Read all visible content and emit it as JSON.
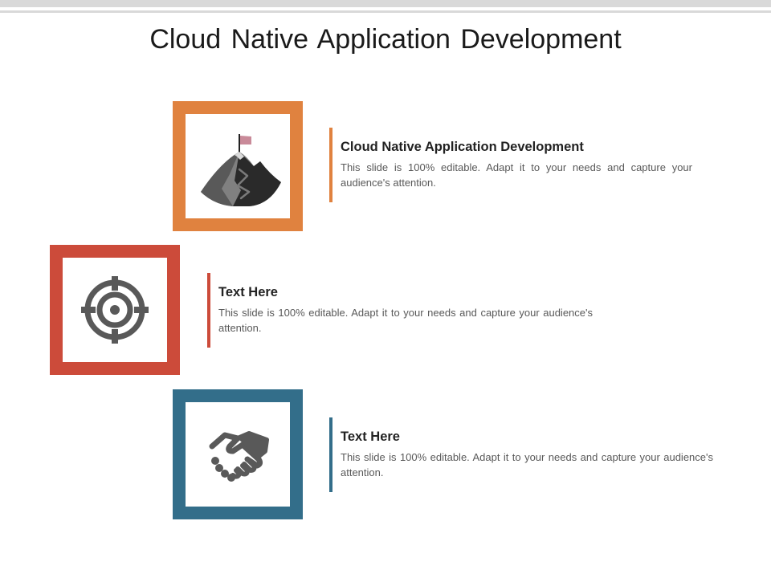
{
  "slide": {
    "title": "Cloud Native Application Development"
  },
  "items": [
    {
      "heading": "Cloud Native Application Development",
      "body": "This slide is 100% editable. Adapt it to your needs and capture your audience's attention.",
      "accent_color": "#E0823F",
      "icon": "mountain-flag-icon"
    },
    {
      "heading": "Text Here",
      "body": "This slide is 100% editable. Adapt it to your needs and capture your audience's attention.",
      "accent_color": "#CC4B3A",
      "icon": "target-icon"
    },
    {
      "heading": "Text Here",
      "body": "This slide is 100% editable. Adapt it to your needs and capture your audience's attention.",
      "accent_color": "#336E8A",
      "icon": "handshake-icon"
    }
  ]
}
